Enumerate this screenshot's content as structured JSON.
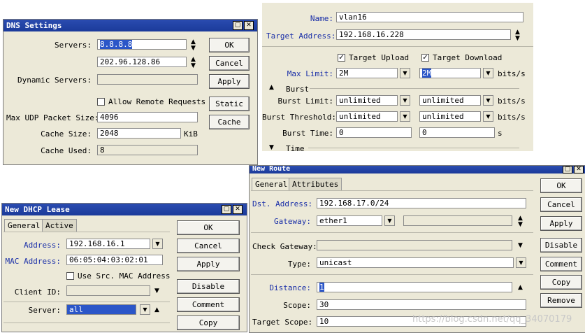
{
  "dns": {
    "title": "DNS Settings",
    "servers_label": "Servers:",
    "server1": "8.8.8.8",
    "server2": "202.96.128.86",
    "dynamic_servers_label": "Dynamic Servers:",
    "allow_remote_label": "Allow Remote Requests",
    "max_udp_label": "Max UDP Packet Size:",
    "max_udp": "4096",
    "cache_size_label": "Cache Size:",
    "cache_size": "2048",
    "cache_size_unit": "KiB",
    "cache_used_label": "Cache Used:",
    "cache_used": "8",
    "btn_ok": "OK",
    "btn_cancel": "Cancel",
    "btn_apply": "Apply",
    "btn_static": "Static",
    "btn_cache": "Cache"
  },
  "queue": {
    "name_label": "Name:",
    "name": "vlan16",
    "target_label": "Target Address:",
    "target": "192.168.16.228",
    "target_upload_label": "Target Upload",
    "target_download_label": "Target Download",
    "max_limit_label": "Max Limit:",
    "max_limit_up": "2M",
    "max_limit_down": "2M",
    "unit": "bits/s",
    "burst_label": "Burst",
    "burst_limit_label": "Burst Limit:",
    "burst_limit_up": "unlimited",
    "burst_limit_down": "unlimited",
    "burst_threshold_label": "Burst Threshold:",
    "burst_threshold_up": "unlimited",
    "burst_threshold_down": "unlimited",
    "burst_time_label": "Burst Time:",
    "burst_time_up": "0",
    "burst_time_down": "0",
    "seconds_unit": "s",
    "time_label": "Time"
  },
  "dhcp": {
    "title": "New DHCP Lease",
    "tab_general": "General",
    "tab_active": "Active",
    "address_label": "Address:",
    "address": "192.168.16.1",
    "mac_label": "MAC Address:",
    "mac": "06:05:04:03:02:01",
    "use_src_mac_label": "Use Src. MAC Address",
    "client_id_label": "Client ID:",
    "client_id": "",
    "server_label": "Server:",
    "server": "all",
    "btn_ok": "OK",
    "btn_cancel": "Cancel",
    "btn_apply": "Apply",
    "btn_disable": "Disable",
    "btn_comment": "Comment",
    "btn_copy": "Copy"
  },
  "route": {
    "title": "New Route",
    "tab_general": "General",
    "tab_attributes": "Attributes",
    "dst_label": "Dst. Address:",
    "dst": "192.168.17.0/24",
    "gateway_label": "Gateway:",
    "gateway": "ether1",
    "check_gateway_label": "Check Gateway:",
    "type_label": "Type:",
    "type": "unicast",
    "distance_label": "Distance:",
    "distance": "1",
    "scope_label": "Scope:",
    "scope": "30",
    "target_scope_label": "Target Scope:",
    "target_scope": "10",
    "btn_ok": "OK",
    "btn_cancel": "Cancel",
    "btn_apply": "Apply",
    "btn_disable": "Disable",
    "btn_comment": "Comment",
    "btn_copy": "Copy",
    "btn_remove": "Remove"
  },
  "watermark": "https://blog.csdn.net/qq_34070179"
}
